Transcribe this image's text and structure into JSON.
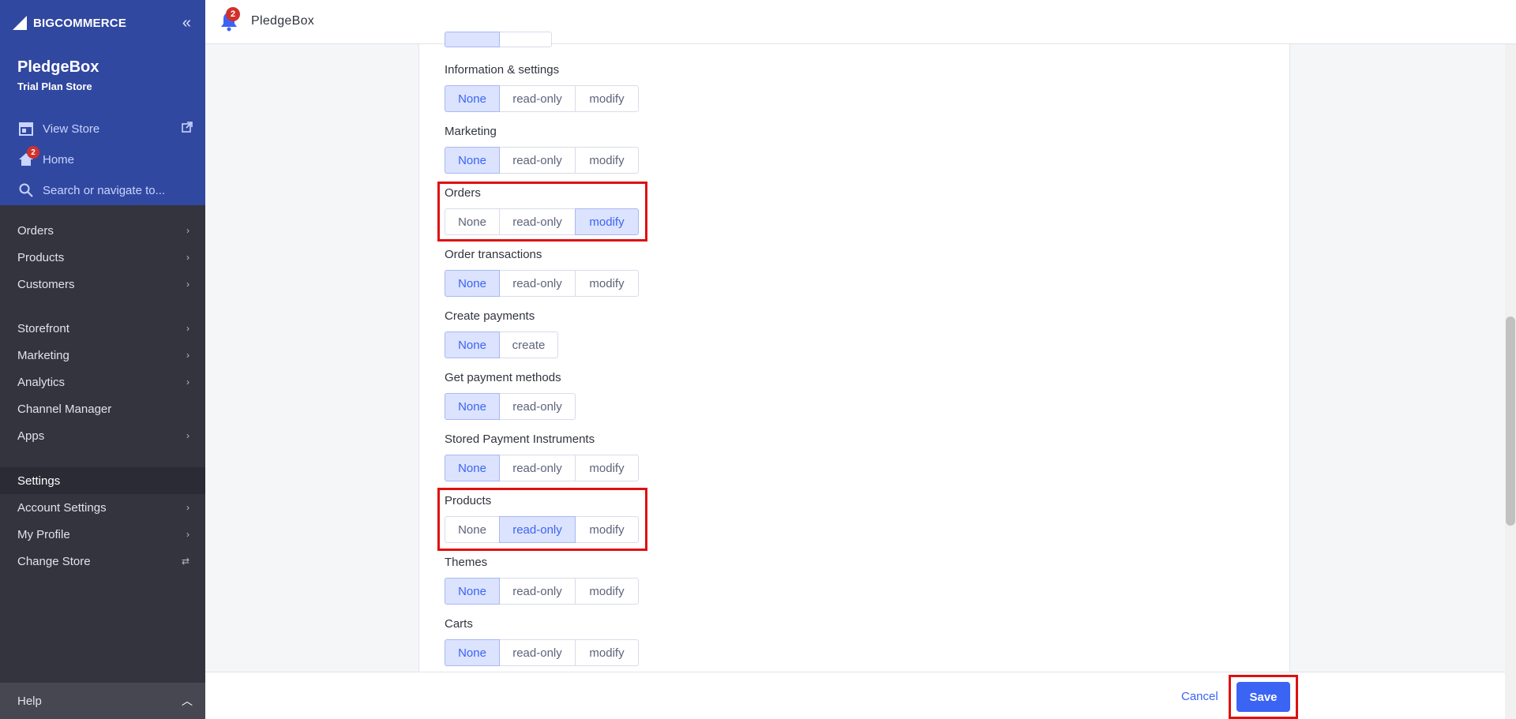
{
  "sidebar": {
    "logo": "BIGCOMMERCE",
    "store_name": "PledgeBox",
    "store_plan": "Trial Plan Store",
    "view_store": "View Store",
    "home": "Home",
    "home_badge": "2",
    "search_placeholder": "Search or navigate to...",
    "items": [
      {
        "label": "Orders"
      },
      {
        "label": "Products"
      },
      {
        "label": "Customers"
      },
      {
        "label": "Storefront"
      },
      {
        "label": "Marketing"
      },
      {
        "label": "Analytics"
      },
      {
        "label": "Channel Manager"
      },
      {
        "label": "Apps"
      },
      {
        "label": "Settings"
      },
      {
        "label": "Account Settings"
      },
      {
        "label": "My Profile"
      },
      {
        "label": "Change Store"
      }
    ],
    "help": "Help"
  },
  "header": {
    "notification_count": "2",
    "title": "PledgeBox"
  },
  "permissions": [
    {
      "label": "Information & settings",
      "options": [
        "None",
        "read-only",
        "modify"
      ],
      "selected": "None"
    },
    {
      "label": "Marketing",
      "options": [
        "None",
        "read-only",
        "modify"
      ],
      "selected": "None"
    },
    {
      "label": "Orders",
      "options": [
        "None",
        "read-only",
        "modify"
      ],
      "selected": "modify"
    },
    {
      "label": "Order transactions",
      "options": [
        "None",
        "read-only",
        "modify"
      ],
      "selected": "None"
    },
    {
      "label": "Create payments",
      "options": [
        "None",
        "create"
      ],
      "selected": "None"
    },
    {
      "label": "Get payment methods",
      "options": [
        "None",
        "read-only"
      ],
      "selected": "None"
    },
    {
      "label": "Stored Payment Instruments",
      "options": [
        "None",
        "read-only",
        "modify"
      ],
      "selected": "None"
    },
    {
      "label": "Products",
      "options": [
        "None",
        "read-only",
        "modify"
      ],
      "selected": "read-only"
    },
    {
      "label": "Themes",
      "options": [
        "None",
        "read-only",
        "modify"
      ],
      "selected": "None"
    },
    {
      "label": "Carts",
      "options": [
        "None",
        "read-only",
        "modify"
      ],
      "selected": "None"
    }
  ],
  "footer": {
    "cancel": "Cancel",
    "save": "Save"
  },
  "colors": {
    "accent": "#3c64f4",
    "sidebar_top": "#3148a0",
    "sidebar": "#34343f",
    "highlight": "#e01010"
  }
}
